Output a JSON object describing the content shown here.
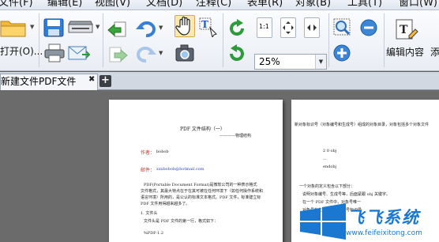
{
  "menu": {
    "items": [
      {
        "label": "文件(F)"
      },
      {
        "label": "编辑(E)"
      },
      {
        "label": "视图(V)"
      },
      {
        "label": "文档(D)"
      },
      {
        "label": "注释(C)"
      },
      {
        "label": "表单(R)"
      },
      {
        "label": "对象(B)"
      },
      {
        "label": "工具(T)"
      },
      {
        "label": "窗口(W)"
      }
    ]
  },
  "toolbar": {
    "open_label": "打开(O)...",
    "zoom_value": "25%",
    "edit_content_label": "编辑内容",
    "add_label": "添",
    "actual_size_text": "1:1"
  },
  "tabs": {
    "active_label": "新建文件PDF文件",
    "close_glyph": "✖",
    "add_glyph": "+"
  },
  "document": {
    "page1": {
      "title": "PDF 文件结构（一）",
      "subtitle": "————物理结构",
      "author_label": "作者：",
      "author_name": "bobob",
      "email_label": "邮件：",
      "email": "xxxbobob@hotmail.com",
      "body_lines": [
        "PDF(Portable Document Format)是微软公司的一种表示格式",
        "文件格式，其最大特点在于在其可被在任何环境下（如任何操作系统和",
        "语言环境）所用的，是公认的标准文本格式。PDF 文件，标准建立标",
        "PDF 文件用得越来越多了。"
      ],
      "section": "1. 文件头",
      "section_body": "文件头是 PDF 文件的第一行，格式如下：",
      "version": "%PDF-1.2"
    },
    "page2": {
      "lines": [
        "新对象标识号（对象编号和生成号）组成的对象目录，对象包括多个对象文件",
        "2 0 obj",
        "...",
        "endobj",
        "一个对象的定义包含以下部分：",
        "说明对象编号、生成号等，后面紧跟 obj 关键字。",
        "在一个 PDF 文件中，对象号唯一",
        "对象号的生成号，由对象号标识号"
      ]
    }
  },
  "watermark": {
    "title": "飞飞系统",
    "url": "www.feifeixitong.com"
  },
  "colors": {
    "accent": "#1a78d0",
    "toolbar_bg": "#eef1f5",
    "workspace_bg": "#6b6b6b"
  }
}
